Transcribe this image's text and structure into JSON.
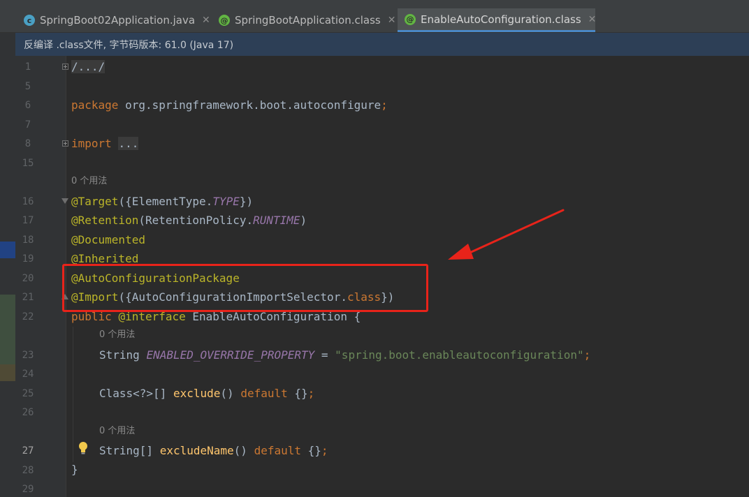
{
  "tabs": [
    {
      "label": "SpringBoot02Application.java",
      "icon": "java-class-icon",
      "active": false
    },
    {
      "label": "SpringBootApplication.class",
      "icon": "annotation-icon",
      "active": false
    },
    {
      "label": "EnableAutoConfiguration.class",
      "icon": "annotation-icon",
      "active": true
    }
  ],
  "banner": {
    "text": "反编译 .class文件, 字节码版本: 61.0 (Java 17)"
  },
  "lines": {
    "n1": "1",
    "n5": "5",
    "n6": "6",
    "n7": "7",
    "n8": "8",
    "n15": "15",
    "n16": "16",
    "n17": "17",
    "n18": "18",
    "n19": "19",
    "n20": "20",
    "n21": "21",
    "n22": "22",
    "n23": "23",
    "n24": "24",
    "n25": "25",
    "n26": "26",
    "n27": "27",
    "n28": "28",
    "n29": "29"
  },
  "code": {
    "fold_comment": "/.../",
    "package_kw": "package",
    "package_name": " org.springframework.boot.autoconfigure",
    "semicolon": ";",
    "import_kw": "import",
    "import_dots": "...",
    "usage_hint_1": "0 个用法",
    "target_ann": "@Target",
    "target_args_open": "({ElementType.",
    "target_const": "TYPE",
    "target_args_close": "})",
    "retention_ann": "@Retention",
    "retention_args_open": "(RetentionPolicy.",
    "retention_const": "RUNTIME",
    "retention_args_close": ")",
    "documented_ann": "@Documented",
    "inherited_ann": "@Inherited",
    "autoconfig_ann": "@AutoConfigurationPackage",
    "import_ann": "@Import",
    "import_args_open": "({AutoConfigurationImportSelector.",
    "import_class_kw": "class",
    "import_args_close": "})",
    "public_kw": "public ",
    "interface_kw": "@interface",
    "interface_name": " EnableAutoConfiguration {",
    "usage_hint_2": "0 个用法",
    "string_type": "String ",
    "field_name": "ENABLED_OVERRIDE_PROPERTY",
    "assign": " = ",
    "field_value": "\"spring.boot.enableautoconfiguration\"",
    "class_type": "Class<?>[] ",
    "exclude_fn": "exclude",
    "parens": "() ",
    "default_kw": "default",
    "empty_braces": " {}",
    "usage_hint_3": "0 个用法",
    "string_arr_type": "String[] ",
    "exclude_name_fn": "excludeName",
    "close_brace": "}"
  },
  "colors": {
    "annotation_box": "#e8231a",
    "arrow": "#e8231a"
  }
}
